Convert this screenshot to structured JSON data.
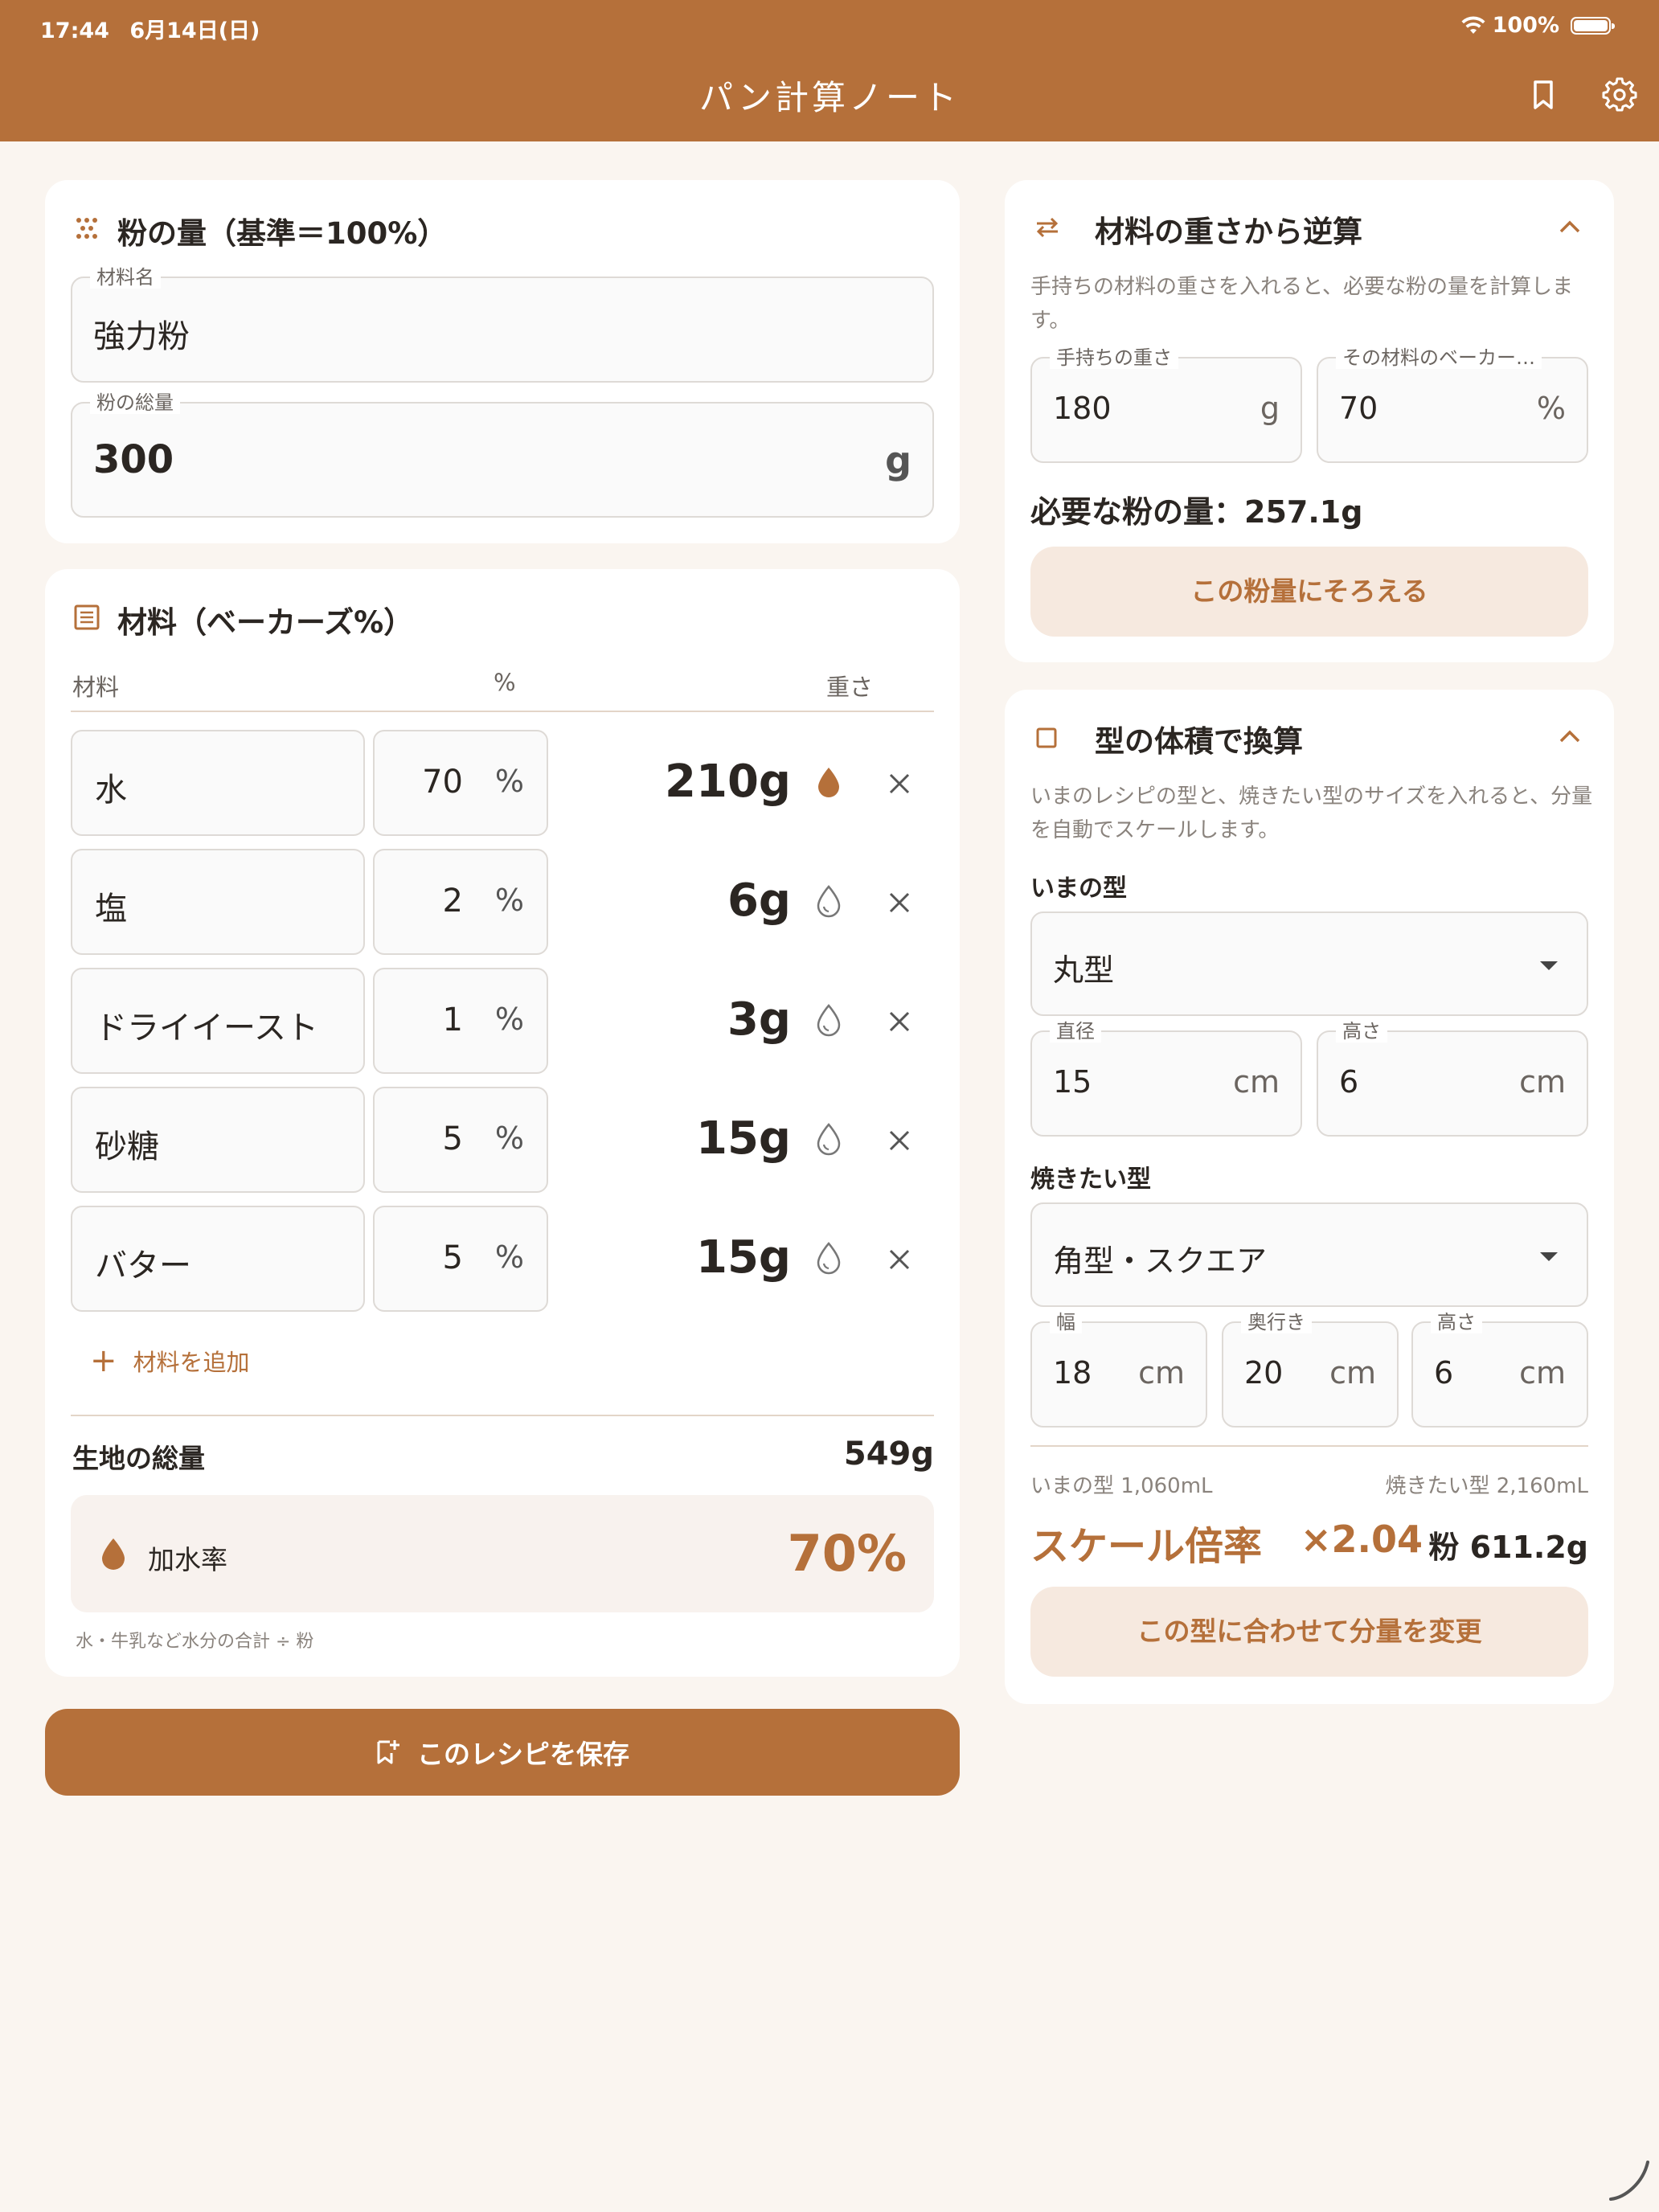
{
  "status_bar": {
    "time": "17:44",
    "date": "6月14日(日)",
    "battery": "100%"
  },
  "app": {
    "title": "パン計算ノート"
  },
  "colors": {
    "primary": "#b5703a",
    "background": "#faf5f0",
    "tonal": "#f6e9df"
  },
  "flour_card": {
    "title": "粉の量（基準＝100%）",
    "name_label": "材料名",
    "name_value": "強力粉",
    "total_label": "粉の総量",
    "total_value": "300",
    "total_unit": "g"
  },
  "ingredients_card": {
    "title": "材料（ベーカーズ%）",
    "col_name": "材料",
    "col_pct": "%",
    "col_weight": "重さ",
    "pct_unit": "%",
    "rows": [
      {
        "name": "水",
        "pct": "70",
        "weight": "210g",
        "water": true
      },
      {
        "name": "塩",
        "pct": "2",
        "weight": "6g",
        "water": false
      },
      {
        "name": "ドライイースト",
        "pct": "1",
        "weight": "3g",
        "water": false
      },
      {
        "name": "砂糖",
        "pct": "5",
        "weight": "15g",
        "water": false
      },
      {
        "name": "バター",
        "pct": "5",
        "weight": "15g",
        "water": false
      }
    ],
    "add_label": "材料を追加",
    "total_dough_label": "生地の総量",
    "total_dough_value": "549g",
    "hydration_label": "加水率",
    "hydration_value": "70%",
    "hydration_note": "水・牛乳など水分の合計 ÷ 粉"
  },
  "save_button": {
    "label": "このレシピを保存"
  },
  "reverse_card": {
    "title": "材料の重さから逆算",
    "description": "手持ちの材料の重さを入れると、必要な粉の量を計算します。",
    "weight_label": "手持ちの重さ",
    "weight_value": "180",
    "weight_unit": "g",
    "pct_label": "その材料のベーカー…",
    "pct_value": "70",
    "pct_unit": "%",
    "result": "必要な粉の量：257.1g",
    "button": "この粉量にそろえる"
  },
  "mold_card": {
    "title": "型の体積で換算",
    "description": "いまのレシピの型と、焼きたい型のサイズを入れると、分量を自動でスケールします。",
    "current_label": "いまの型",
    "current_type": "丸型",
    "diameter_label": "直径",
    "diameter_value": "15",
    "height_label": "高さ",
    "height_value": "6",
    "unit_cm": "cm",
    "target_label": "焼きたい型",
    "target_type": "角型・スクエア",
    "width_label": "幅",
    "width_value": "18",
    "depth_label": "奥行き",
    "depth_value": "20",
    "t_height_label": "高さ",
    "t_height_value": "6",
    "current_volume": "いまの型 1,060mL",
    "target_volume": "焼きたい型 2,160mL",
    "scale_label": "スケール倍率",
    "scale_value": "×2.04",
    "flour_result": "粉 611.2g",
    "button": "この型に合わせて分量を変更"
  }
}
